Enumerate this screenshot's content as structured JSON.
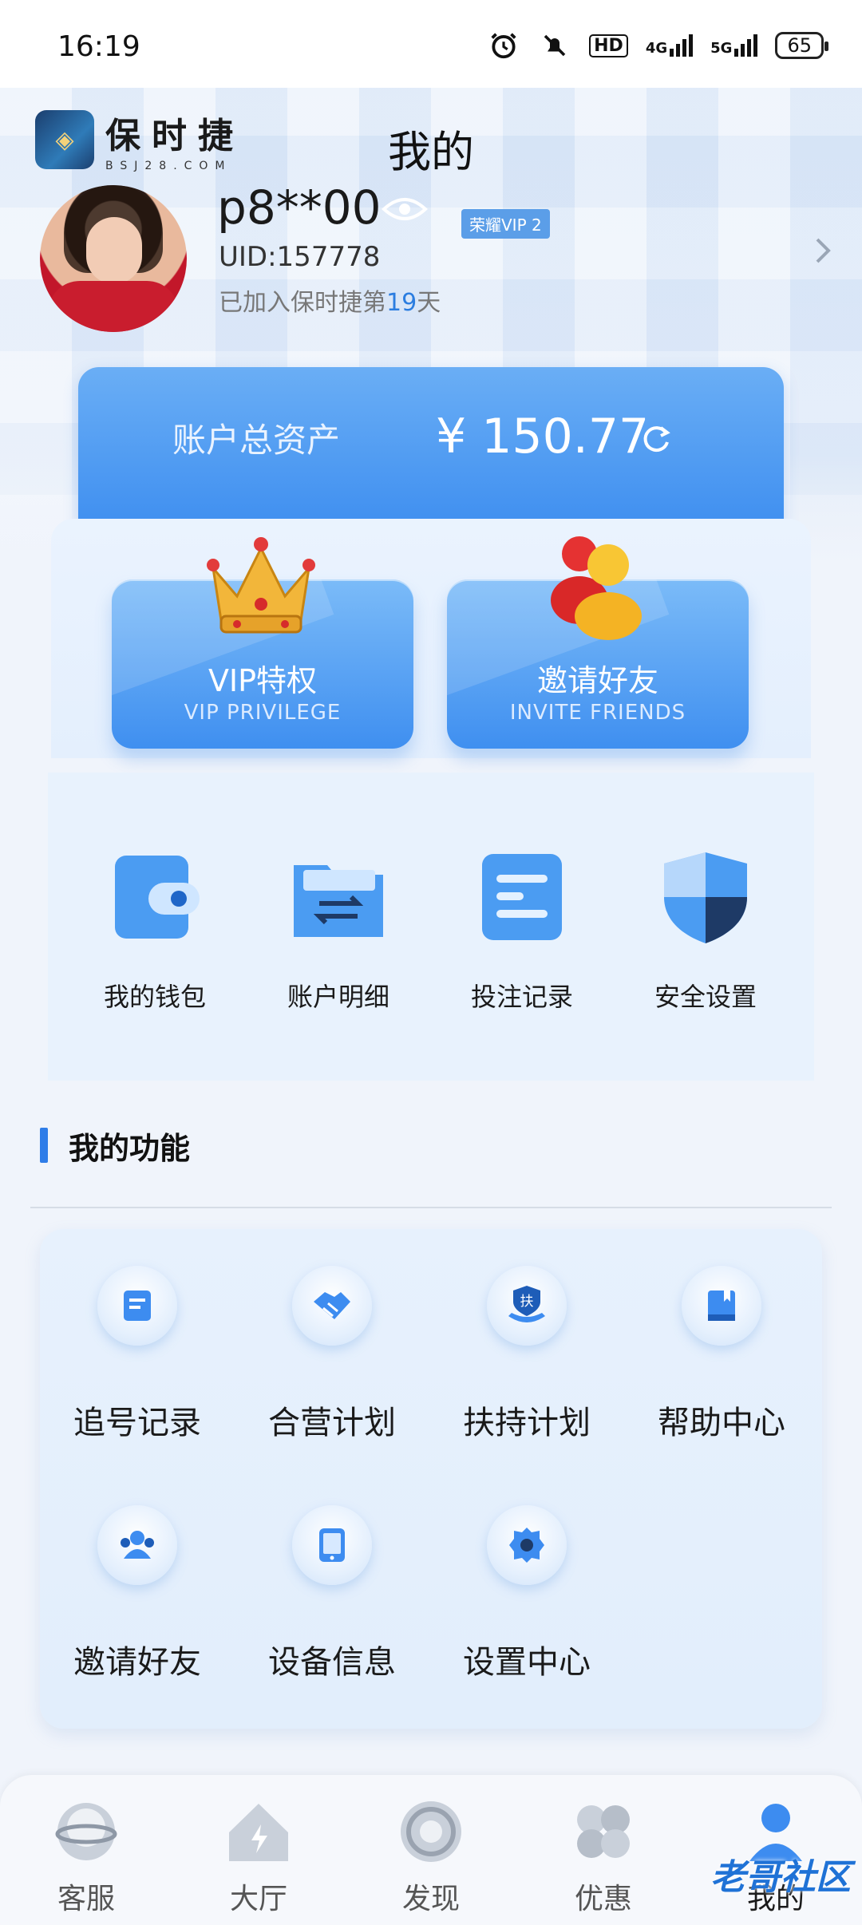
{
  "status_bar": {
    "time": "16:19",
    "hd_label": "HD",
    "net1": "4G",
    "net2": "5G",
    "battery": "65"
  },
  "header": {
    "logo_title": "保时捷",
    "logo_sub": "BSJ28.COM",
    "page_title": "我的"
  },
  "profile": {
    "username": "p8**00",
    "vip_badge": "荣耀VIP 2",
    "uid": "UID:157778",
    "joined_prefix": "已加入保时捷第",
    "joined_days": "19",
    "joined_suffix": "天"
  },
  "balance": {
    "label": "账户总资产",
    "value": "¥ 150.77"
  },
  "promo": [
    {
      "title": "VIP特权",
      "sub": "VIP PRIVILEGE"
    },
    {
      "title": "邀请好友",
      "sub": "INVITE FRIENDS"
    }
  ],
  "quick_actions": [
    {
      "label": "我的钱包",
      "icon": "wallet-icon"
    },
    {
      "label": "账户明细",
      "icon": "folder-transfer-icon"
    },
    {
      "label": "投注记录",
      "icon": "document-icon"
    },
    {
      "label": "安全设置",
      "icon": "shield-icon"
    }
  ],
  "functions": {
    "title": "我的功能",
    "items": [
      {
        "label": "追号记录",
        "icon": "note-icon"
      },
      {
        "label": "合营计划",
        "icon": "handshake-icon"
      },
      {
        "label": "扶持计划",
        "icon": "support-icon",
        "glyph": "扶"
      },
      {
        "label": "帮助中心",
        "icon": "book-icon"
      },
      {
        "label": "邀请好友",
        "icon": "users-icon"
      },
      {
        "label": "设备信息",
        "icon": "tablet-icon"
      },
      {
        "label": "设置中心",
        "icon": "gear-icon"
      }
    ]
  },
  "bottom_nav": [
    {
      "label": "客服",
      "icon": "headset-icon"
    },
    {
      "label": "大厅",
      "icon": "home-icon"
    },
    {
      "label": "发现",
      "icon": "discover-icon"
    },
    {
      "label": "优惠",
      "icon": "clover-icon"
    },
    {
      "label": "我的",
      "icon": "user-icon",
      "active": true
    }
  ],
  "watermark": "老哥社区",
  "colors": {
    "accent": "#3f8ff0",
    "days_highlight": "#2b7de0",
    "vip_badge_bg": "#5b9ee8"
  }
}
